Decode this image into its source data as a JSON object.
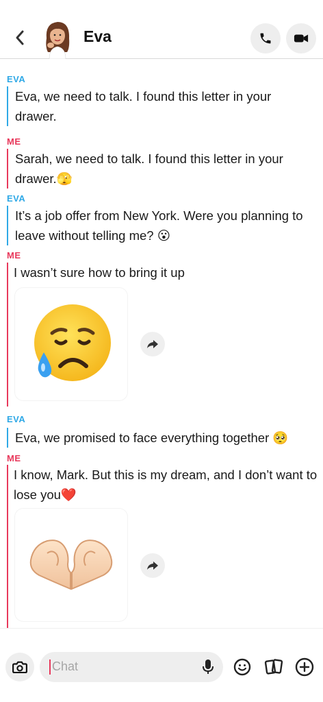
{
  "header": {
    "title": "Eva",
    "back_icon": "chevron-left-icon",
    "call_icon": "phone-icon",
    "video_icon": "video-camera-icon"
  },
  "messages": [
    {
      "sender": "EVA",
      "text": "Eva, we need to talk. I found this letter in your drawer."
    },
    {
      "sender": "ME",
      "text": "Sarah, we need to talk. I found this letter in your drawer.",
      "emoji": "🫣"
    },
    {
      "sender": "EVA",
      "text": "It’s a job offer from New York. Were you planning to leave without telling me?",
      "emoji": "😮"
    },
    {
      "sender": "ME",
      "text": "I wasn’t sure how to bring it up",
      "sticker": "sad-relieved-face-emoji"
    },
    {
      "sender": "EVA",
      "text": "Eva, we promised to face everything together",
      "emoji": "🥺"
    },
    {
      "sender": "ME",
      "text": "I know, Mark. But this is my dream, and I don’t want to lose you",
      "emoji": "❤️",
      "sticker": "heart-hands-emoji"
    }
  ],
  "input": {
    "placeholder": "Chat"
  },
  "colors": {
    "eva": "#2ea8e6",
    "me": "#e8385b"
  }
}
